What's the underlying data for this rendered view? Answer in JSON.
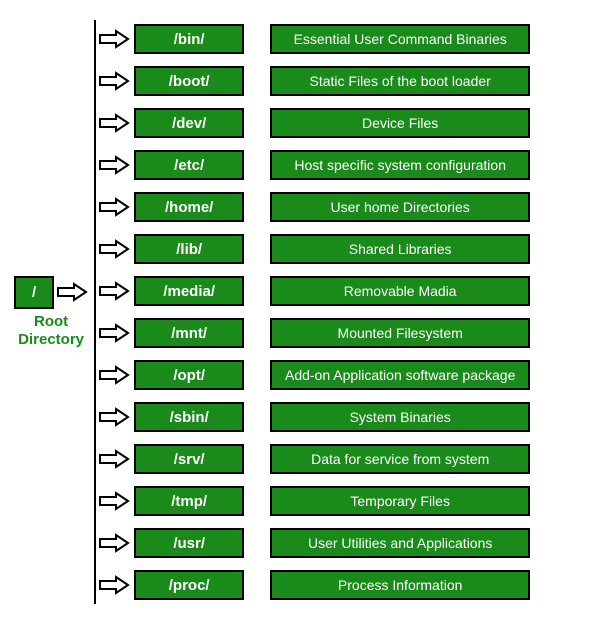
{
  "root": {
    "symbol": "/",
    "label_line1": "Root",
    "label_line2": "Directory"
  },
  "entries": [
    {
      "dir": "/bin/",
      "desc": "Essential User Command Binaries"
    },
    {
      "dir": "/boot/",
      "desc": "Static Files of the boot loader"
    },
    {
      "dir": "/dev/",
      "desc": "Device Files"
    },
    {
      "dir": "/etc/",
      "desc": "Host specific system configuration"
    },
    {
      "dir": "/home/",
      "desc": "User home Directories"
    },
    {
      "dir": "/lib/",
      "desc": "Shared Libraries"
    },
    {
      "dir": "/media/",
      "desc": "Removable Madia"
    },
    {
      "dir": "/mnt/",
      "desc": "Mounted Filesystem"
    },
    {
      "dir": "/opt/",
      "desc": "Add-on Application software package"
    },
    {
      "dir": "/sbin/",
      "desc": "System Binaries"
    },
    {
      "dir": "/srv/",
      "desc": "Data for service from system"
    },
    {
      "dir": "/tmp/",
      "desc": "Temporary Files"
    },
    {
      "dir": "/usr/",
      "desc": "User Utilities and Applications"
    },
    {
      "dir": "/proc/",
      "desc": "Process Information"
    }
  ],
  "colors": {
    "box_fill": "#1a8a1a",
    "box_border": "#000000",
    "text": "#ffffff",
    "root_label": "#1a8a1a"
  }
}
